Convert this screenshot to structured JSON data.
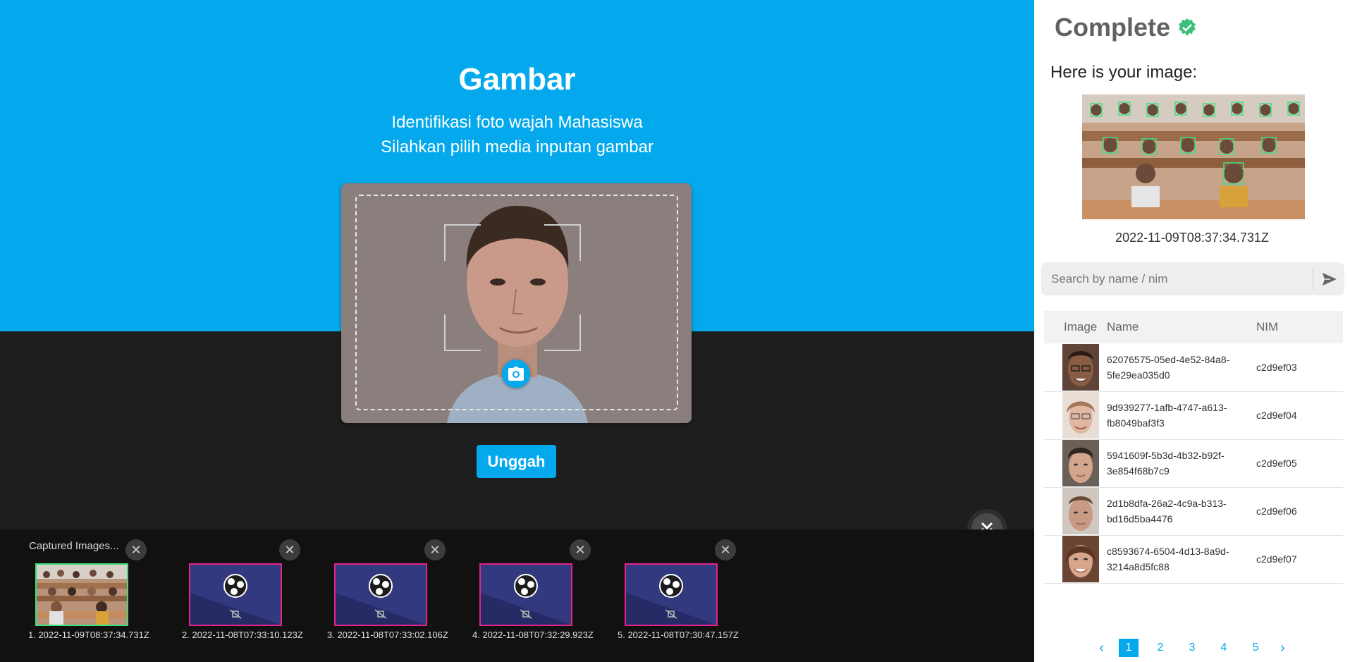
{
  "main": {
    "title": "Gambar",
    "subtitle_line1": "Identifikasi foto wajah Mahasiswa",
    "subtitle_line2": "Silahkan pilih media inputan gambar",
    "upload_label": "Unggah"
  },
  "captured": {
    "title": "Captured Images...",
    "items": [
      {
        "caption": "1. 2022-11-09T08:37:34.731Z",
        "selected": true
      },
      {
        "caption": "2. 2022-11-08T07:33:10.123Z",
        "selected": false
      },
      {
        "caption": "3. 2022-11-08T07:33:02.106Z",
        "selected": false
      },
      {
        "caption": "4. 2022-11-08T07:32:29.923Z",
        "selected": false
      },
      {
        "caption": "5. 2022-11-08T07:30:47.157Z",
        "selected": false
      }
    ]
  },
  "panel": {
    "title": "Complete",
    "subtitle": "Here is your image:",
    "image_timestamp": "2022-11-09T08:37:34.731Z",
    "search": {
      "placeholder": "Search by name / nim"
    },
    "table": {
      "headers": [
        "Image",
        "Name",
        "NIM"
      ],
      "rows": [
        {
          "name_line1": "62076575-05ed-4e52-84a8-",
          "name_line2": "5fe29ea035d0",
          "nim": "c2d9ef03"
        },
        {
          "name_line1": "9d939277-1afb-4747-a613-",
          "name_line2": "fb8049baf3f3",
          "nim": "c2d9ef04"
        },
        {
          "name_line1": "5941609f-5b3d-4b32-b92f-",
          "name_line2": "3e854f68b7c9",
          "nim": "c2d9ef05"
        },
        {
          "name_line1": "2d1b8dfa-26a2-4c9a-b313-",
          "name_line2": "bd16d5ba4476",
          "nim": "c2d9ef06"
        },
        {
          "name_line1": "c8593674-6504-4d13-8a9d-",
          "name_line2": "3214a8d5fc88",
          "nim": "c2d9ef07"
        }
      ]
    },
    "pagination": {
      "pages": [
        "1",
        "2",
        "3",
        "4",
        "5"
      ],
      "current": "1"
    }
  },
  "colors": {
    "accent": "#03a9ec",
    "success": "#3bbf7a",
    "thumb_border": "#e5218a"
  },
  "icons": {
    "camera": "camera-icon",
    "verified": "verified-badge-icon",
    "send": "send-icon",
    "collapse": "double-chevron-down-icon",
    "close": "close-icon",
    "obs_logo": "obs-logo-icon",
    "muted_camera": "camera-off-icon"
  }
}
